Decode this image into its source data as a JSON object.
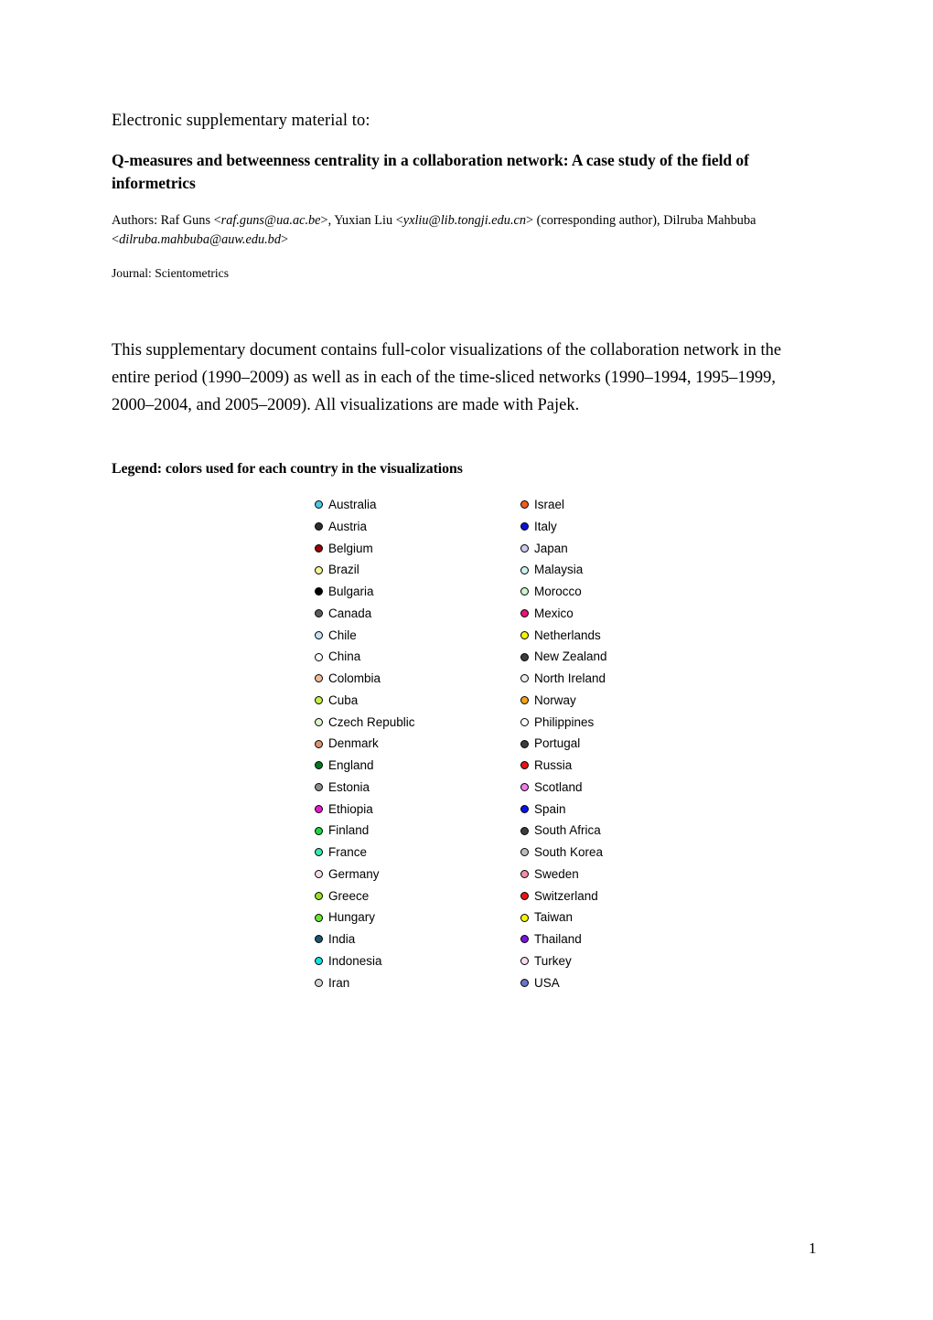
{
  "document": {
    "esm_line": "Electronic supplementary material to:",
    "title": "Q-measures and betweenness centrality in a collaboration network: A case study of the field of informetrics",
    "authors": {
      "prefix": "Authors: Raf Guns <",
      "email1": "raf.guns@ua.ac.be",
      "mid1": ">, Yuxian Liu <",
      "email2": "yxliu@lib.tongji.edu.cn",
      "mid2": "> (corresponding author), Dilruba Mahbuba <",
      "email3": "dilruba.mahbuba@auw.edu.bd",
      "suffix": ">"
    },
    "journal": "Journal: Scientometrics",
    "intro": "This supplementary document contains full-color visualizations of the collaboration network in the entire period (1990–2009) as well as in each of the time-sliced networks (1990–1994, 1995–1999, 2000–2004, and 2005–2009). All visualizations are made with Pajek.",
    "legend_heading": "Legend: colors used for each country in the visualizations",
    "page_number": "1"
  },
  "legend": {
    "left_column": [
      {
        "country": "Australia",
        "color": "#4cc7e8"
      },
      {
        "country": "Austria",
        "color": "#2e2e2e"
      },
      {
        "country": "Belgium",
        "color": "#990000"
      },
      {
        "country": "Brazil",
        "color": "#f5f59a"
      },
      {
        "country": "Bulgaria",
        "color": "#000000"
      },
      {
        "country": "Canada",
        "color": "#5c5c5c"
      },
      {
        "country": "Chile",
        "color": "#c5e4f5"
      },
      {
        "country": "China",
        "color": "#ffffff"
      },
      {
        "country": "Colombia",
        "color": "#f2bb9a"
      },
      {
        "country": "Cuba",
        "color": "#c6f046"
      },
      {
        "country": "Czech Republic",
        "color": "#ddf5c8"
      },
      {
        "country": "Denmark",
        "color": "#de9470"
      },
      {
        "country": "England",
        "color": "#007a1e"
      },
      {
        "country": "Estonia",
        "color": "#8f8f8f"
      },
      {
        "country": "Ethiopia",
        "color": "#e81ad0"
      },
      {
        "country": "Finland",
        "color": "#17d93f"
      },
      {
        "country": "France",
        "color": "#38e8b5"
      },
      {
        "country": "Germany",
        "color": "#f5dced"
      },
      {
        "country": "Greece",
        "color": "#9ae022"
      },
      {
        "country": "Hungary",
        "color": "#66e833"
      },
      {
        "country": "India",
        "color": "#1a5673"
      },
      {
        "country": "Indonesia",
        "color": "#11e2e2"
      },
      {
        "country": "Iran",
        "color": "#d6d6d6"
      }
    ],
    "right_column": [
      {
        "country": "Israel",
        "color": "#f25c1e"
      },
      {
        "country": "Italy",
        "color": "#0a14d6"
      },
      {
        "country": "Japan",
        "color": "#ccccee"
      },
      {
        "country": "Malaysia",
        "color": "#ccf2f2"
      },
      {
        "country": "Morocco",
        "color": "#ccf5cc"
      },
      {
        "country": "Mexico",
        "color": "#e8147a"
      },
      {
        "country": "Netherlands",
        "color": "#f5f500"
      },
      {
        "country": "New Zealand",
        "color": "#3d3d3d"
      },
      {
        "country": "North Ireland",
        "color": "#ededed"
      },
      {
        "country": "Norway",
        "color": "#f2a317"
      },
      {
        "country": "Philippines",
        "color": "#ffffff"
      },
      {
        "country": "Portugal",
        "color": "#3d3d3d"
      },
      {
        "country": "Russia",
        "color": "#e81414"
      },
      {
        "country": "Scotland",
        "color": "#ef7ee8"
      },
      {
        "country": "Spain",
        "color": "#0a14e8"
      },
      {
        "country": "South Africa",
        "color": "#3d3d3d"
      },
      {
        "country": "South Korea",
        "color": "#bdbdbd"
      },
      {
        "country": "Sweden",
        "color": "#f08fa8"
      },
      {
        "country": "Switzerland",
        "color": "#ef1414"
      },
      {
        "country": "Taiwan",
        "color": "#f5f500"
      },
      {
        "country": "Thailand",
        "color": "#7a14e0"
      },
      {
        "country": "Turkey",
        "color": "#f7dced"
      },
      {
        "country": "USA",
        "color": "#6b75c4"
      }
    ]
  }
}
